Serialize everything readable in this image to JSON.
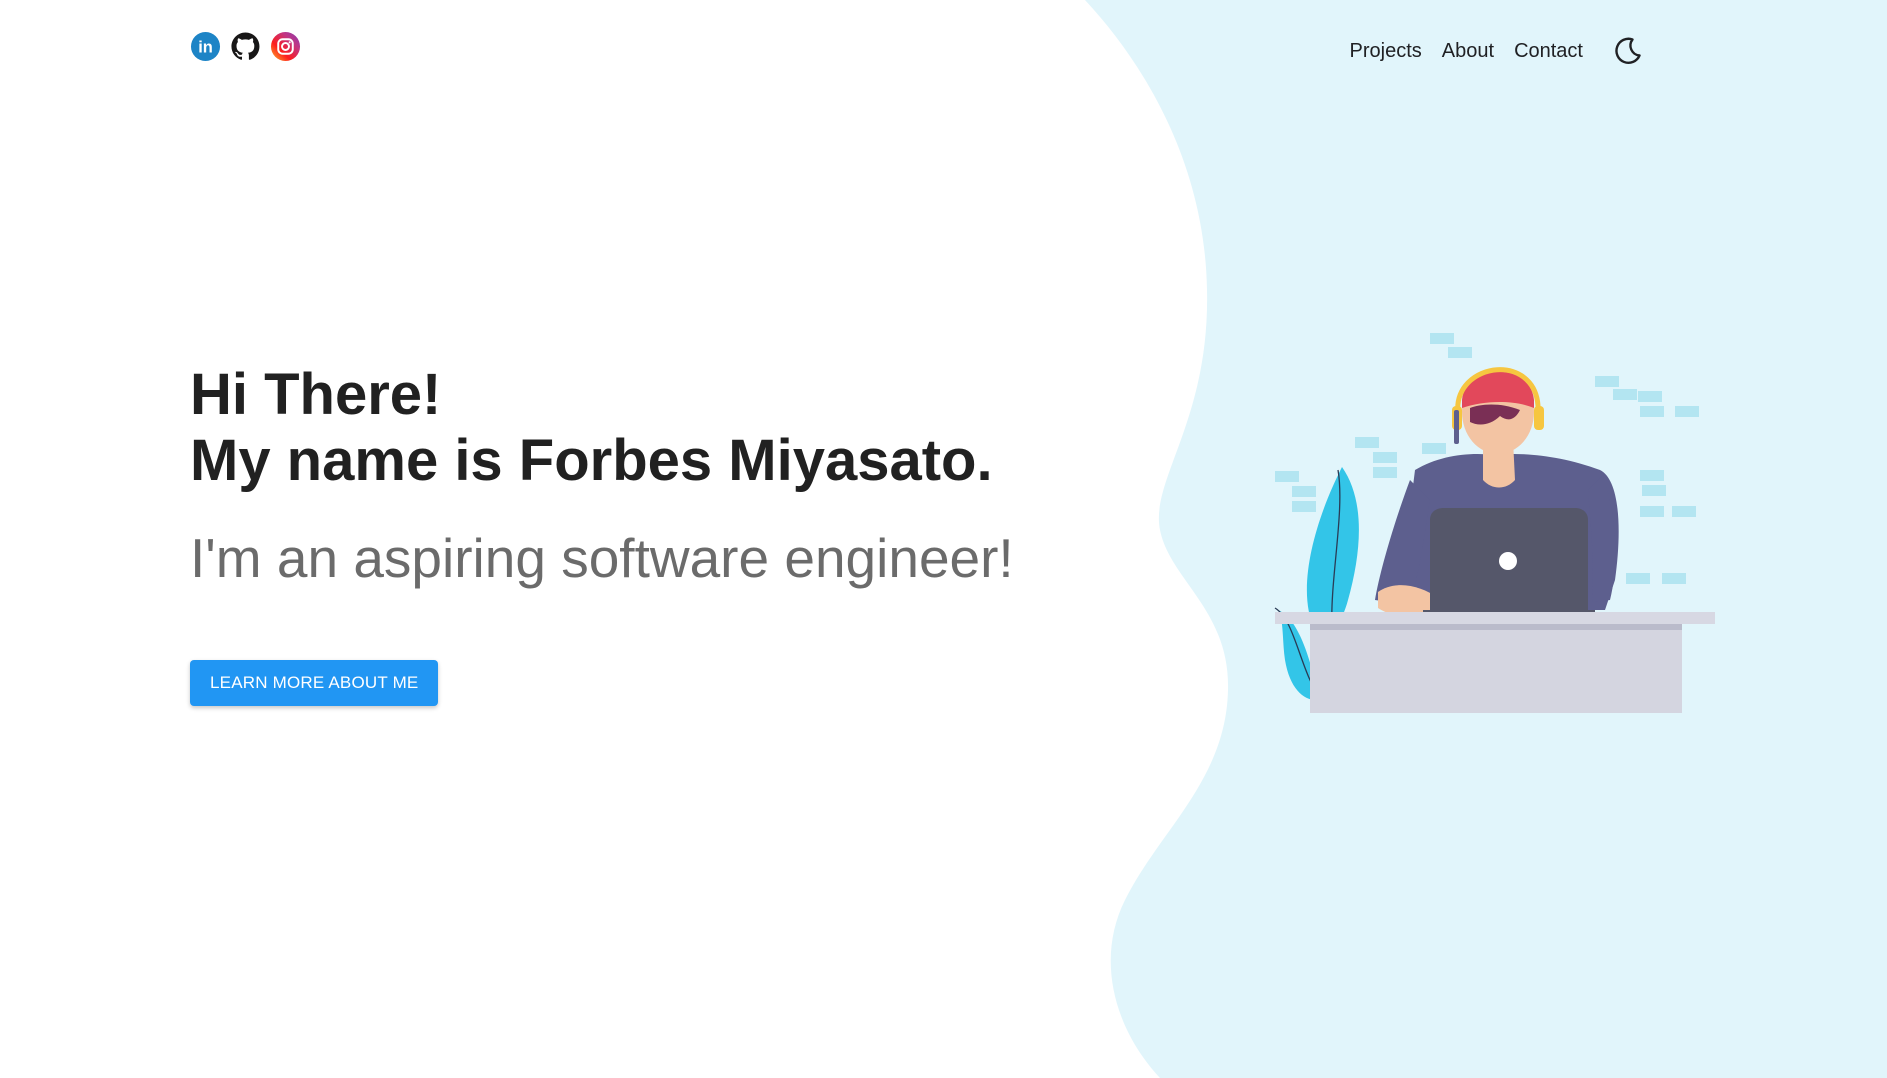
{
  "social": {
    "linkedin_label": "in"
  },
  "nav": {
    "items": [
      {
        "label": "Projects"
      },
      {
        "label": "About"
      },
      {
        "label": "Contact"
      }
    ],
    "theme_icon": "moon-icon"
  },
  "hero": {
    "greeting": "Hi There!",
    "name_line": "My name is Forbes Miyasato.",
    "subtitle": "I'm an aspiring software engineer!",
    "cta_label": "LEARN MORE ABOUT ME"
  },
  "colors": {
    "accent": "#2196f3",
    "blob": "#e1f5fb",
    "heading": "#212121",
    "subtitle": "#6b6b6b"
  },
  "icons": [
    "linkedin-icon",
    "github-icon",
    "instagram-icon",
    "moon-icon"
  ]
}
